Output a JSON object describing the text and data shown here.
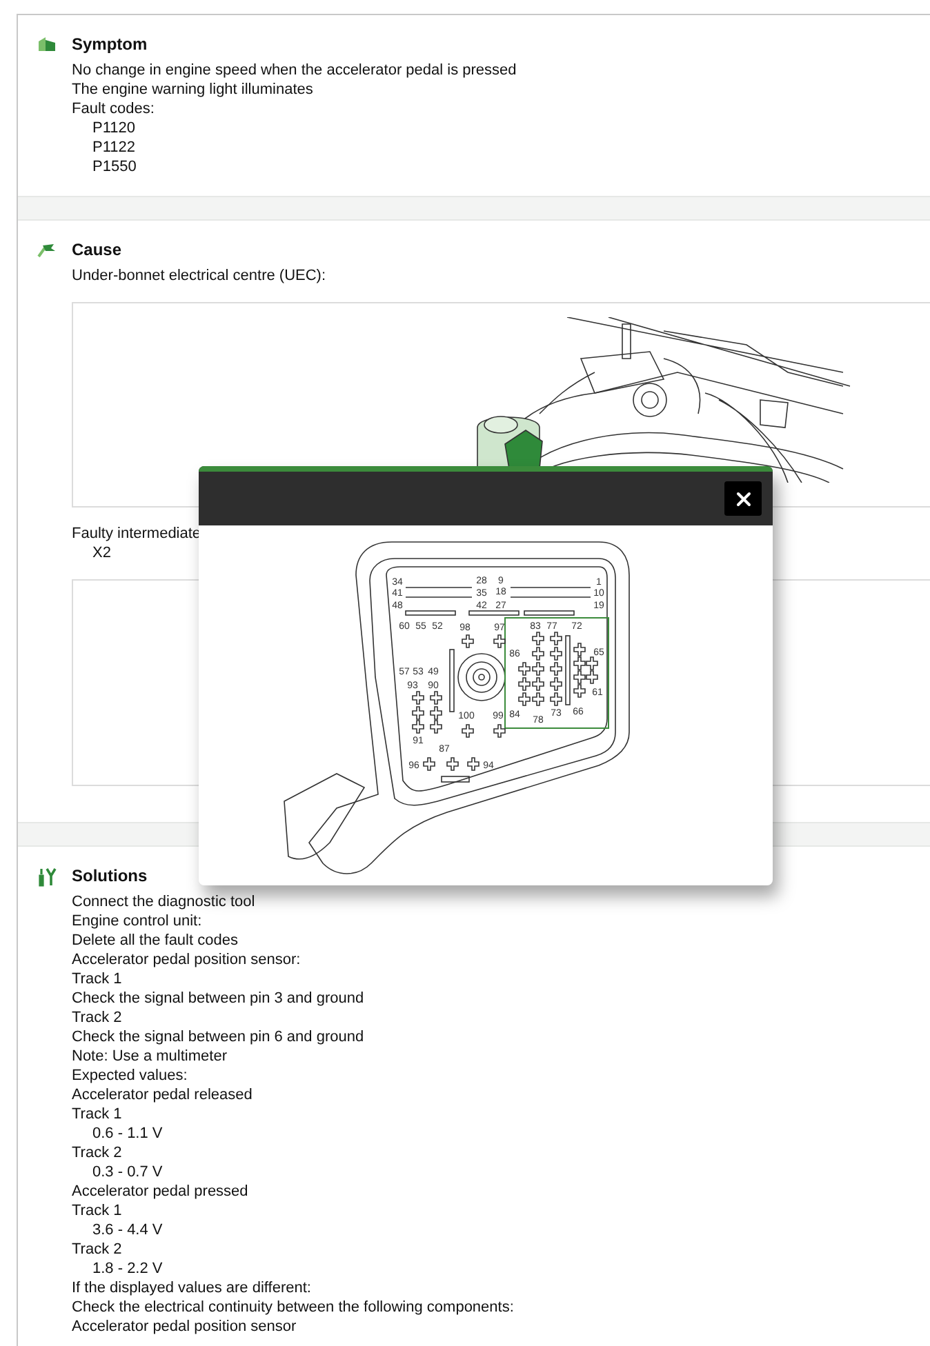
{
  "sections": [
    {
      "kind": "symptom",
      "title": "Symptom",
      "lines": [
        {
          "kind": "text",
          "text": "No change in engine speed when the accelerator pedal is pressed"
        },
        {
          "kind": "text",
          "text": "The engine warning light illuminates"
        },
        {
          "kind": "text",
          "text": "Fault codes:"
        },
        {
          "kind": "value",
          "text": "P1120"
        },
        {
          "kind": "value",
          "text": "P1122"
        },
        {
          "kind": "value",
          "text": "P1550"
        }
      ]
    },
    {
      "kind": "cause",
      "title": "Cause",
      "lines": [
        {
          "kind": "text",
          "text": "Under-bonnet electrical centre (UEC):"
        },
        {
          "kind": "engine_figure"
        },
        {
          "kind": "text",
          "text": "Faulty intermediate"
        },
        {
          "kind": "value",
          "text": "X2"
        },
        {
          "kind": "empty_figure"
        }
      ]
    },
    {
      "kind": "solutions",
      "title": "Solutions",
      "lines": [
        {
          "kind": "text",
          "text": "Connect the diagnostic tool"
        },
        {
          "kind": "text",
          "text": "Engine control unit:"
        },
        {
          "kind": "text",
          "text": "Delete all the fault codes"
        },
        {
          "kind": "text",
          "text": "Accelerator pedal position sensor:"
        },
        {
          "kind": "text",
          "text": "Track 1"
        },
        {
          "kind": "text",
          "text": "Check the signal between pin 3 and ground"
        },
        {
          "kind": "text",
          "text": "Track 2"
        },
        {
          "kind": "text",
          "text": "Check the signal between pin 6 and ground"
        },
        {
          "kind": "text",
          "text": "Note: Use a multimeter"
        },
        {
          "kind": "text",
          "text": "Expected values:"
        },
        {
          "kind": "text",
          "text": "Accelerator pedal released"
        },
        {
          "kind": "text",
          "text": "Track 1"
        },
        {
          "kind": "value",
          "text": "0.6 - 1.1 V"
        },
        {
          "kind": "text",
          "text": "Track 2"
        },
        {
          "kind": "value",
          "text": "0.3 - 0.7 V"
        },
        {
          "kind": "text",
          "text": "Accelerator pedal pressed"
        },
        {
          "kind": "text",
          "text": "Track 1"
        },
        {
          "kind": "value",
          "text": "3.6 - 4.4 V"
        },
        {
          "kind": "text",
          "text": "Track 2"
        },
        {
          "kind": "value",
          "text": "1.8 - 2.2 V"
        },
        {
          "kind": "text",
          "text": "If the displayed values are different:"
        },
        {
          "kind": "text",
          "text": "Check the electrical continuity between the following components:"
        },
        {
          "kind": "text",
          "text": "Accelerator pedal position sensor"
        }
      ]
    }
  ],
  "modal": {
    "pins": [
      "34",
      "41",
      "48",
      "28",
      "35",
      "42",
      "9",
      "18",
      "27",
      "1",
      "10",
      "19",
      "60",
      "55",
      "52",
      "98",
      "97",
      "83",
      "77",
      "72",
      "86",
      "65",
      "57",
      "53",
      "49",
      "93",
      "90",
      "61",
      "84",
      "73",
      "66",
      "78",
      "100",
      "99",
      "91",
      "87",
      "96",
      "94"
    ]
  }
}
